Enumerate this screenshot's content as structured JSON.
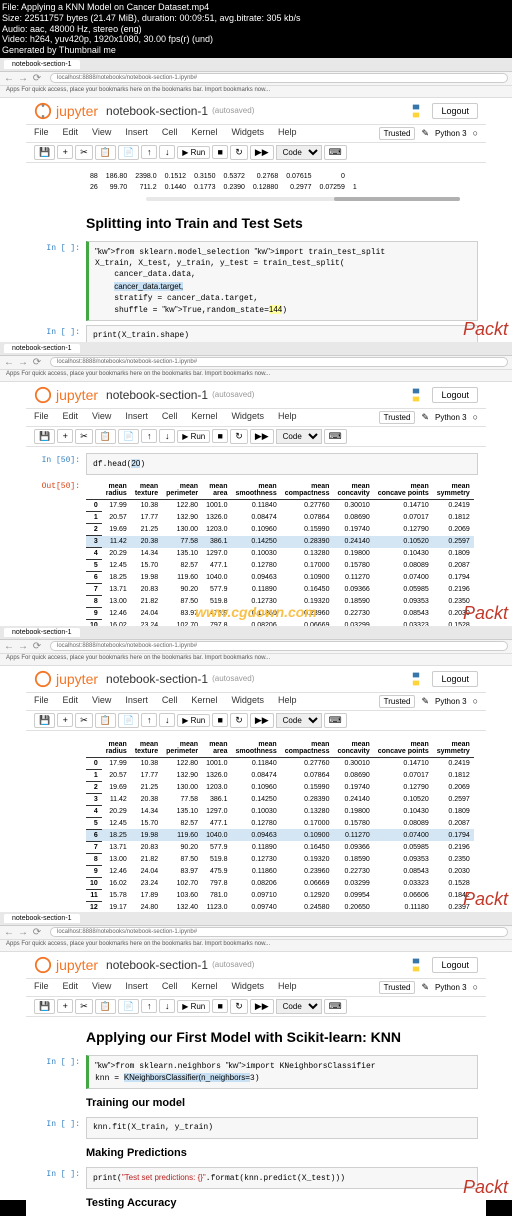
{
  "metadata": {
    "line1": "File: Applying a KNN Model on Cancer Dataset.mp4",
    "line2": "Size: 22511757 bytes (21.47 MiB), duration: 00:09:51, avg.bitrate: 305 kb/s",
    "line3": "Audio: aac, 48000 Hz, stereo (eng)",
    "line4": "Video: h264, yuv420p, 1920x1080, 30.00 fps(r) (und)",
    "line5": "Generated by Thumbnail me"
  },
  "browser": {
    "tab_title": "notebook-section-1",
    "url": "localhost:8888/notebooks/notebook-section-1.ipynb#",
    "bookmark": "Apps  For quick access, place your bookmarks here on the bookmarks bar. Import bookmarks now..."
  },
  "notebook": {
    "logo": "jupyter",
    "title": "notebook-section-1",
    "autosave": "(autosaved)",
    "logout": "Logout",
    "trusted": "Trusted",
    "kernel": "Python 3",
    "menu": [
      "File",
      "Edit",
      "View",
      "Insert",
      "Cell",
      "Kernel",
      "Widgets",
      "Help"
    ],
    "run_btn": "▶ Run",
    "cell_type": "Code"
  },
  "panel1": {
    "table_rows": [
      {
        "idx": "88",
        "c1": "186.80",
        "c2": "2398.0",
        "c3": "0.1512",
        "c4": "0.3150",
        "c5": "0.5372",
        "c6": "0.2768",
        "c7": "0.07615",
        "c8": "0"
      },
      {
        "idx": "26",
        "c1": "99.70",
        "c2": "711.2",
        "c3": "0.1440",
        "c4": "0.1773",
        "c5": "0.2390",
        "c6": "0.12880",
        "c7": "0.2977",
        "c8": "0.07259",
        "c9": "1"
      }
    ],
    "heading": "Splitting into Train and Test Sets",
    "code1": "from sklearn.model_selection import train_test_split\nX_train, X_test, y_train, y_test = train_test_split(\n    cancer_data.data,\n    cancer_data.target,\n    stratify = cancer_data.target,\n    shuffle = True,random_state=144)",
    "code2": "print(X_train.shape)\nprint(X_test.shape)\nprint(y_train.shape)"
  },
  "panel2": {
    "in_prompt": "In [50]:",
    "out_prompt": "Out[50]:",
    "code": "df.head(20)",
    "headers": [
      "",
      "mean radius",
      "mean texture",
      "mean perimeter",
      "mean area",
      "mean smoothness",
      "mean compactness",
      "mean concavity",
      "mean concave points",
      "mean symmetry"
    ],
    "rows": [
      [
        "0",
        "17.99",
        "10.38",
        "122.80",
        "1001.0",
        "0.11840",
        "0.27760",
        "0.30010",
        "0.14710",
        "0.2419"
      ],
      [
        "1",
        "20.57",
        "17.77",
        "132.90",
        "1326.0",
        "0.08474",
        "0.07864",
        "0.08690",
        "0.07017",
        "0.1812"
      ],
      [
        "2",
        "19.69",
        "21.25",
        "130.00",
        "1203.0",
        "0.10960",
        "0.15990",
        "0.19740",
        "0.12790",
        "0.2069"
      ],
      [
        "3",
        "11.42",
        "20.38",
        "77.58",
        "386.1",
        "0.14250",
        "0.28390",
        "0.24140",
        "0.10520",
        "0.2597"
      ],
      [
        "4",
        "20.29",
        "14.34",
        "135.10",
        "1297.0",
        "0.10030",
        "0.13280",
        "0.19800",
        "0.10430",
        "0.1809"
      ],
      [
        "5",
        "12.45",
        "15.70",
        "82.57",
        "477.1",
        "0.12780",
        "0.17000",
        "0.15780",
        "0.08089",
        "0.2087"
      ],
      [
        "6",
        "18.25",
        "19.98",
        "119.60",
        "1040.0",
        "0.09463",
        "0.10900",
        "0.11270",
        "0.07400",
        "0.1794"
      ],
      [
        "7",
        "13.71",
        "20.83",
        "90.20",
        "577.9",
        "0.11890",
        "0.16450",
        "0.09366",
        "0.05985",
        "0.2196"
      ],
      [
        "8",
        "13.00",
        "21.82",
        "87.50",
        "519.8",
        "0.12730",
        "0.19320",
        "0.18590",
        "0.09353",
        "0.2350"
      ],
      [
        "9",
        "12.46",
        "24.04",
        "83.97",
        "475.9",
        "0.11860",
        "0.23960",
        "0.22730",
        "0.08543",
        "0.2030"
      ],
      [
        "10",
        "16.02",
        "23.24",
        "102.70",
        "797.8",
        "0.08206",
        "0.06669",
        "0.03299",
        "0.03323",
        "0.1528"
      ]
    ],
    "hl_row": 3
  },
  "panel3": {
    "headers": [
      "",
      "mean radius",
      "mean texture",
      "mean perimeter",
      "mean area",
      "mean smoothness",
      "mean compactness",
      "mean concavity",
      "mean concave points",
      "mean symmetry"
    ],
    "rows": [
      [
        "0",
        "17.99",
        "10.38",
        "122.80",
        "1001.0",
        "0.11840",
        "0.27760",
        "0.30010",
        "0.14710",
        "0.2419"
      ],
      [
        "1",
        "20.57",
        "17.77",
        "132.90",
        "1326.0",
        "0.08474",
        "0.07864",
        "0.08690",
        "0.07017",
        "0.1812"
      ],
      [
        "2",
        "19.69",
        "21.25",
        "130.00",
        "1203.0",
        "0.10960",
        "0.15990",
        "0.19740",
        "0.12790",
        "0.2069"
      ],
      [
        "3",
        "11.42",
        "20.38",
        "77.58",
        "386.1",
        "0.14250",
        "0.28390",
        "0.24140",
        "0.10520",
        "0.2597"
      ],
      [
        "4",
        "20.29",
        "14.34",
        "135.10",
        "1297.0",
        "0.10030",
        "0.13280",
        "0.19800",
        "0.10430",
        "0.1809"
      ],
      [
        "5",
        "12.45",
        "15.70",
        "82.57",
        "477.1",
        "0.12780",
        "0.17000",
        "0.15780",
        "0.08089",
        "0.2087"
      ],
      [
        "6",
        "18.25",
        "19.98",
        "119.60",
        "1040.0",
        "0.09463",
        "0.10900",
        "0.11270",
        "0.07400",
        "0.1794"
      ],
      [
        "7",
        "13.71",
        "20.83",
        "90.20",
        "577.9",
        "0.11890",
        "0.16450",
        "0.09366",
        "0.05985",
        "0.2196"
      ],
      [
        "8",
        "13.00",
        "21.82",
        "87.50",
        "519.8",
        "0.12730",
        "0.19320",
        "0.18590",
        "0.09353",
        "0.2350"
      ],
      [
        "9",
        "12.46",
        "24.04",
        "83.97",
        "475.9",
        "0.11860",
        "0.23960",
        "0.22730",
        "0.08543",
        "0.2030"
      ],
      [
        "10",
        "16.02",
        "23.24",
        "102.70",
        "797.8",
        "0.08206",
        "0.06669",
        "0.03299",
        "0.03323",
        "0.1528"
      ],
      [
        "11",
        "15.78",
        "17.89",
        "103.60",
        "781.0",
        "0.09710",
        "0.12920",
        "0.09954",
        "0.06606",
        "0.1842"
      ],
      [
        "12",
        "19.17",
        "24.80",
        "132.40",
        "1123.0",
        "0.09740",
        "0.24580",
        "0.20650",
        "0.11180",
        "0.2397"
      ]
    ],
    "hl_row": 6
  },
  "panel4": {
    "heading": "Applying our First Model with Scikit-learn: KNN",
    "code1": "from sklearn.neighbors import KNeighborsClassifier\nknn = KNeighborsClassifier(n_neighbors=3)",
    "heading2": "Training our model",
    "code2": "knn.fit(X_train, y_train)",
    "heading3": "Making Predictions",
    "code3": "print(\"Test set predictions: {}\".format(knn.predict(X_test)))",
    "heading4": "Testing Accuracy"
  },
  "watermark": "Packt",
  "watermark_center": "www.cgdown.com"
}
